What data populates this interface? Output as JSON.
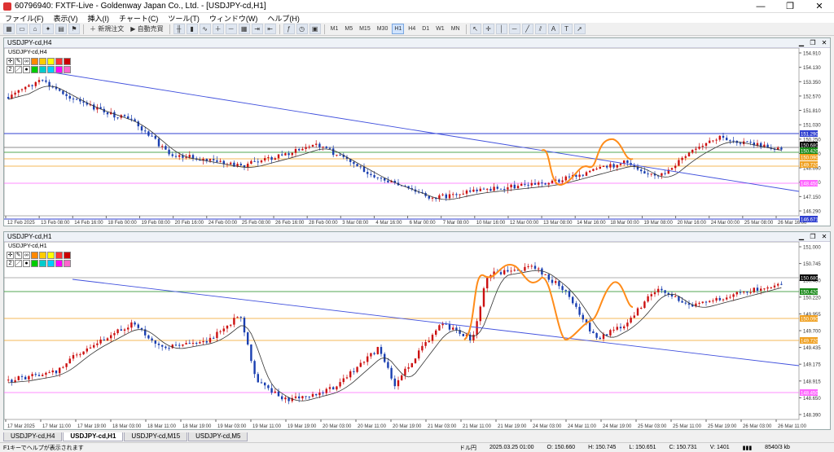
{
  "window": {
    "title": "60796940: FXTF-Live - Goldenway Japan Co., Ltd. - [USDJPY-cd,H1]",
    "minimize": "—",
    "maximize": "❐",
    "close": "✕"
  },
  "menu": [
    "ファイル(F)",
    "表示(V)",
    "挿入(I)",
    "チャート(C)",
    "ツール(T)",
    "ウィンドウ(W)",
    "ヘルプ(H)"
  ],
  "toolbar": {
    "new_order": "新規注文",
    "auto_trading": "自動売買",
    "timeframes": [
      "M1",
      "M5",
      "M15",
      "M30",
      "H1",
      "H4",
      "D1",
      "W1",
      "MN"
    ],
    "active_timeframe": "H1"
  },
  "chart_top": {
    "label": "USDJPY-cd,H4",
    "x_labels": [
      "12 Feb 2025",
      "13 Feb 08:00",
      "14 Feb 16:00",
      "18 Feb 00:00",
      "19 Feb 08:00",
      "20 Feb 16:00",
      "24 Feb 00:00",
      "25 Feb 08:00",
      "26 Feb 16:00",
      "28 Feb 00:00",
      "3 Mar 08:00",
      "4 Mar 16:00",
      "6 Mar 00:00",
      "7 Mar 08:00",
      "10 Mar 16:00",
      "12 Mar 00:00",
      "13 Mar 08:00",
      "14 Mar 16:00",
      "18 Mar 00:00",
      "19 Mar 08:00",
      "20 Mar 16:00",
      "24 Mar 00:00",
      "25 Mar 08:00",
      "26 Mar 16:00"
    ],
    "y_labels": [
      "154.910",
      "154.130",
      "153.350",
      "152.570",
      "151.810",
      "151.030",
      "150.250",
      "149.470",
      "148.690",
      "147.930",
      "147.150",
      "146.290"
    ],
    "price_tags": [
      {
        "value": "151.290",
        "color": "#3040d0"
      },
      {
        "value": "150.680",
        "color": "#000000"
      },
      {
        "value": "150.420",
        "color": "#1a8a1a"
      },
      {
        "value": "150.090",
        "color": "#f0a020"
      },
      {
        "value": "149.720",
        "color": "#f0a020"
      },
      {
        "value": "148.450",
        "color": "#ff66ff"
      },
      {
        "value": "146.671",
        "color": "#3040d0"
      }
    ]
  },
  "chart_bottom": {
    "label": "USDJPY-cd,H1",
    "x_labels": [
      "17 Mar 2025",
      "17 Mar 11:00",
      "17 Mar 19:00",
      "18 Mar 03:00",
      "18 Mar 11:00",
      "18 Mar 19:00",
      "19 Mar 03:00",
      "19 Mar 11:00",
      "19 Mar 19:00",
      "20 Mar 03:00",
      "20 Mar 11:00",
      "20 Mar 19:00",
      "21 Mar 03:00",
      "21 Mar 11:00",
      "21 Mar 19:00",
      "24 Mar 03:00",
      "24 Mar 11:00",
      "24 Mar 19:00",
      "25 Mar 03:00",
      "25 Mar 11:00",
      "25 Mar 19:00",
      "26 Mar 03:00",
      "26 Mar 11:00"
    ],
    "y_labels": [
      "151.000",
      "150.745",
      "150.480",
      "150.220",
      "149.955",
      "149.700",
      "149.435",
      "149.175",
      "148.915",
      "148.650",
      "148.390"
    ],
    "price_tags": [
      {
        "value": "150.680",
        "color": "#000000"
      },
      {
        "value": "150.420",
        "color": "#1a8a1a"
      },
      {
        "value": "150.090",
        "color": "#f0a020"
      },
      {
        "value": "149.720",
        "color": "#f0a020"
      },
      {
        "value": "148.450",
        "color": "#ff66ff"
      }
    ]
  },
  "palette": {
    "colors": [
      "#ff8800",
      "#ffcc00",
      "#ffff00",
      "#ff3333",
      "#cc0000",
      "#00cc00",
      "#00cccc",
      "#00ccff",
      "#ff00ff",
      "#ff66cc"
    ],
    "row_nums": [
      "1",
      "2"
    ]
  },
  "tabs": [
    "USDJPY-cd,H4",
    "USDJPY-cd,H1",
    "USDJPY-cd,M15",
    "USDJPY-cd,M5"
  ],
  "active_tab": "USDJPY-cd,H1",
  "status": {
    "help": "F1キーでヘルプが表示されます",
    "profile": "ドル円",
    "datetime": "2025.03.25 01:00",
    "open": "O: 150.660",
    "high": "H: 150.745",
    "low": "L: 150.651",
    "close": "C: 150.731",
    "volume": "V: 1401",
    "traffic": "8540/3 kb"
  }
}
